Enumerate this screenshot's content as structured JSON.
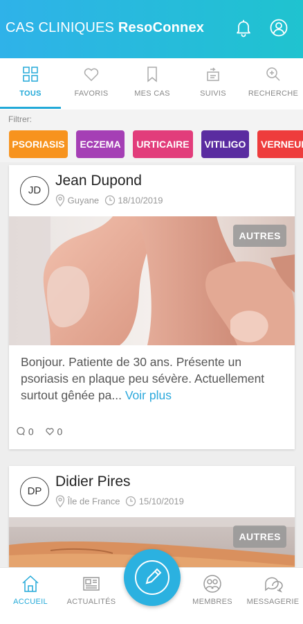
{
  "header": {
    "title_light": "CAS CLINIQUES",
    "title_bold": "ResoConnex",
    "icons": [
      "bell-icon",
      "user-icon"
    ]
  },
  "tabs": [
    {
      "label": "TOUS",
      "icon": "grid-icon",
      "active": true
    },
    {
      "label": "FAVORIS",
      "icon": "heart-icon",
      "active": false
    },
    {
      "label": "MES CAS",
      "icon": "bookmark-icon",
      "active": false
    },
    {
      "label": "SUIVIS",
      "icon": "follow-icon",
      "active": false
    },
    {
      "label": "RECHERCHE",
      "icon": "search-icon",
      "active": false
    }
  ],
  "filter": {
    "label": "Filtrer:",
    "chips": [
      {
        "label": "PSORIASIS",
        "color": "#f7931e"
      },
      {
        "label": "ECZEMA",
        "color": "#a53fb5"
      },
      {
        "label": "URTICAIRE",
        "color": "#e23d7b"
      },
      {
        "label": "VITILIGO",
        "color": "#5a2ca0"
      },
      {
        "label": "VERNEUI",
        "color": "#ee3c3c"
      }
    ]
  },
  "posts": [
    {
      "initials": "JD",
      "author": "Jean Dupond",
      "location": "Guyane",
      "date": "18/10/2019",
      "badge": "AUTRES",
      "excerpt": "Bonjour. Patiente de 30 ans. Présente un psoriasis en plaque peu sévère. Actuellement surtout gênée pa...",
      "more_label": "Voir plus",
      "comments": "0",
      "likes": "0"
    },
    {
      "initials": "DP",
      "author": "Didier Pires",
      "location": "Île de France",
      "date": "15/10/2019",
      "badge": "AUTRES"
    }
  ],
  "bottom_nav": [
    {
      "label": "ACCUEIL",
      "icon": "home-icon",
      "active": true
    },
    {
      "label": "ACTUALITÉS",
      "icon": "news-icon",
      "active": false
    },
    {
      "label": "MEMBRES",
      "icon": "members-icon",
      "active": false
    },
    {
      "label": "MESSAGERIE",
      "icon": "chat-icon",
      "active": false
    }
  ],
  "fab_icon": "pencil-icon",
  "colors": {
    "accent": "#22a9d8",
    "header_start": "#2fb2e9",
    "header_end": "#1fc3cf"
  }
}
